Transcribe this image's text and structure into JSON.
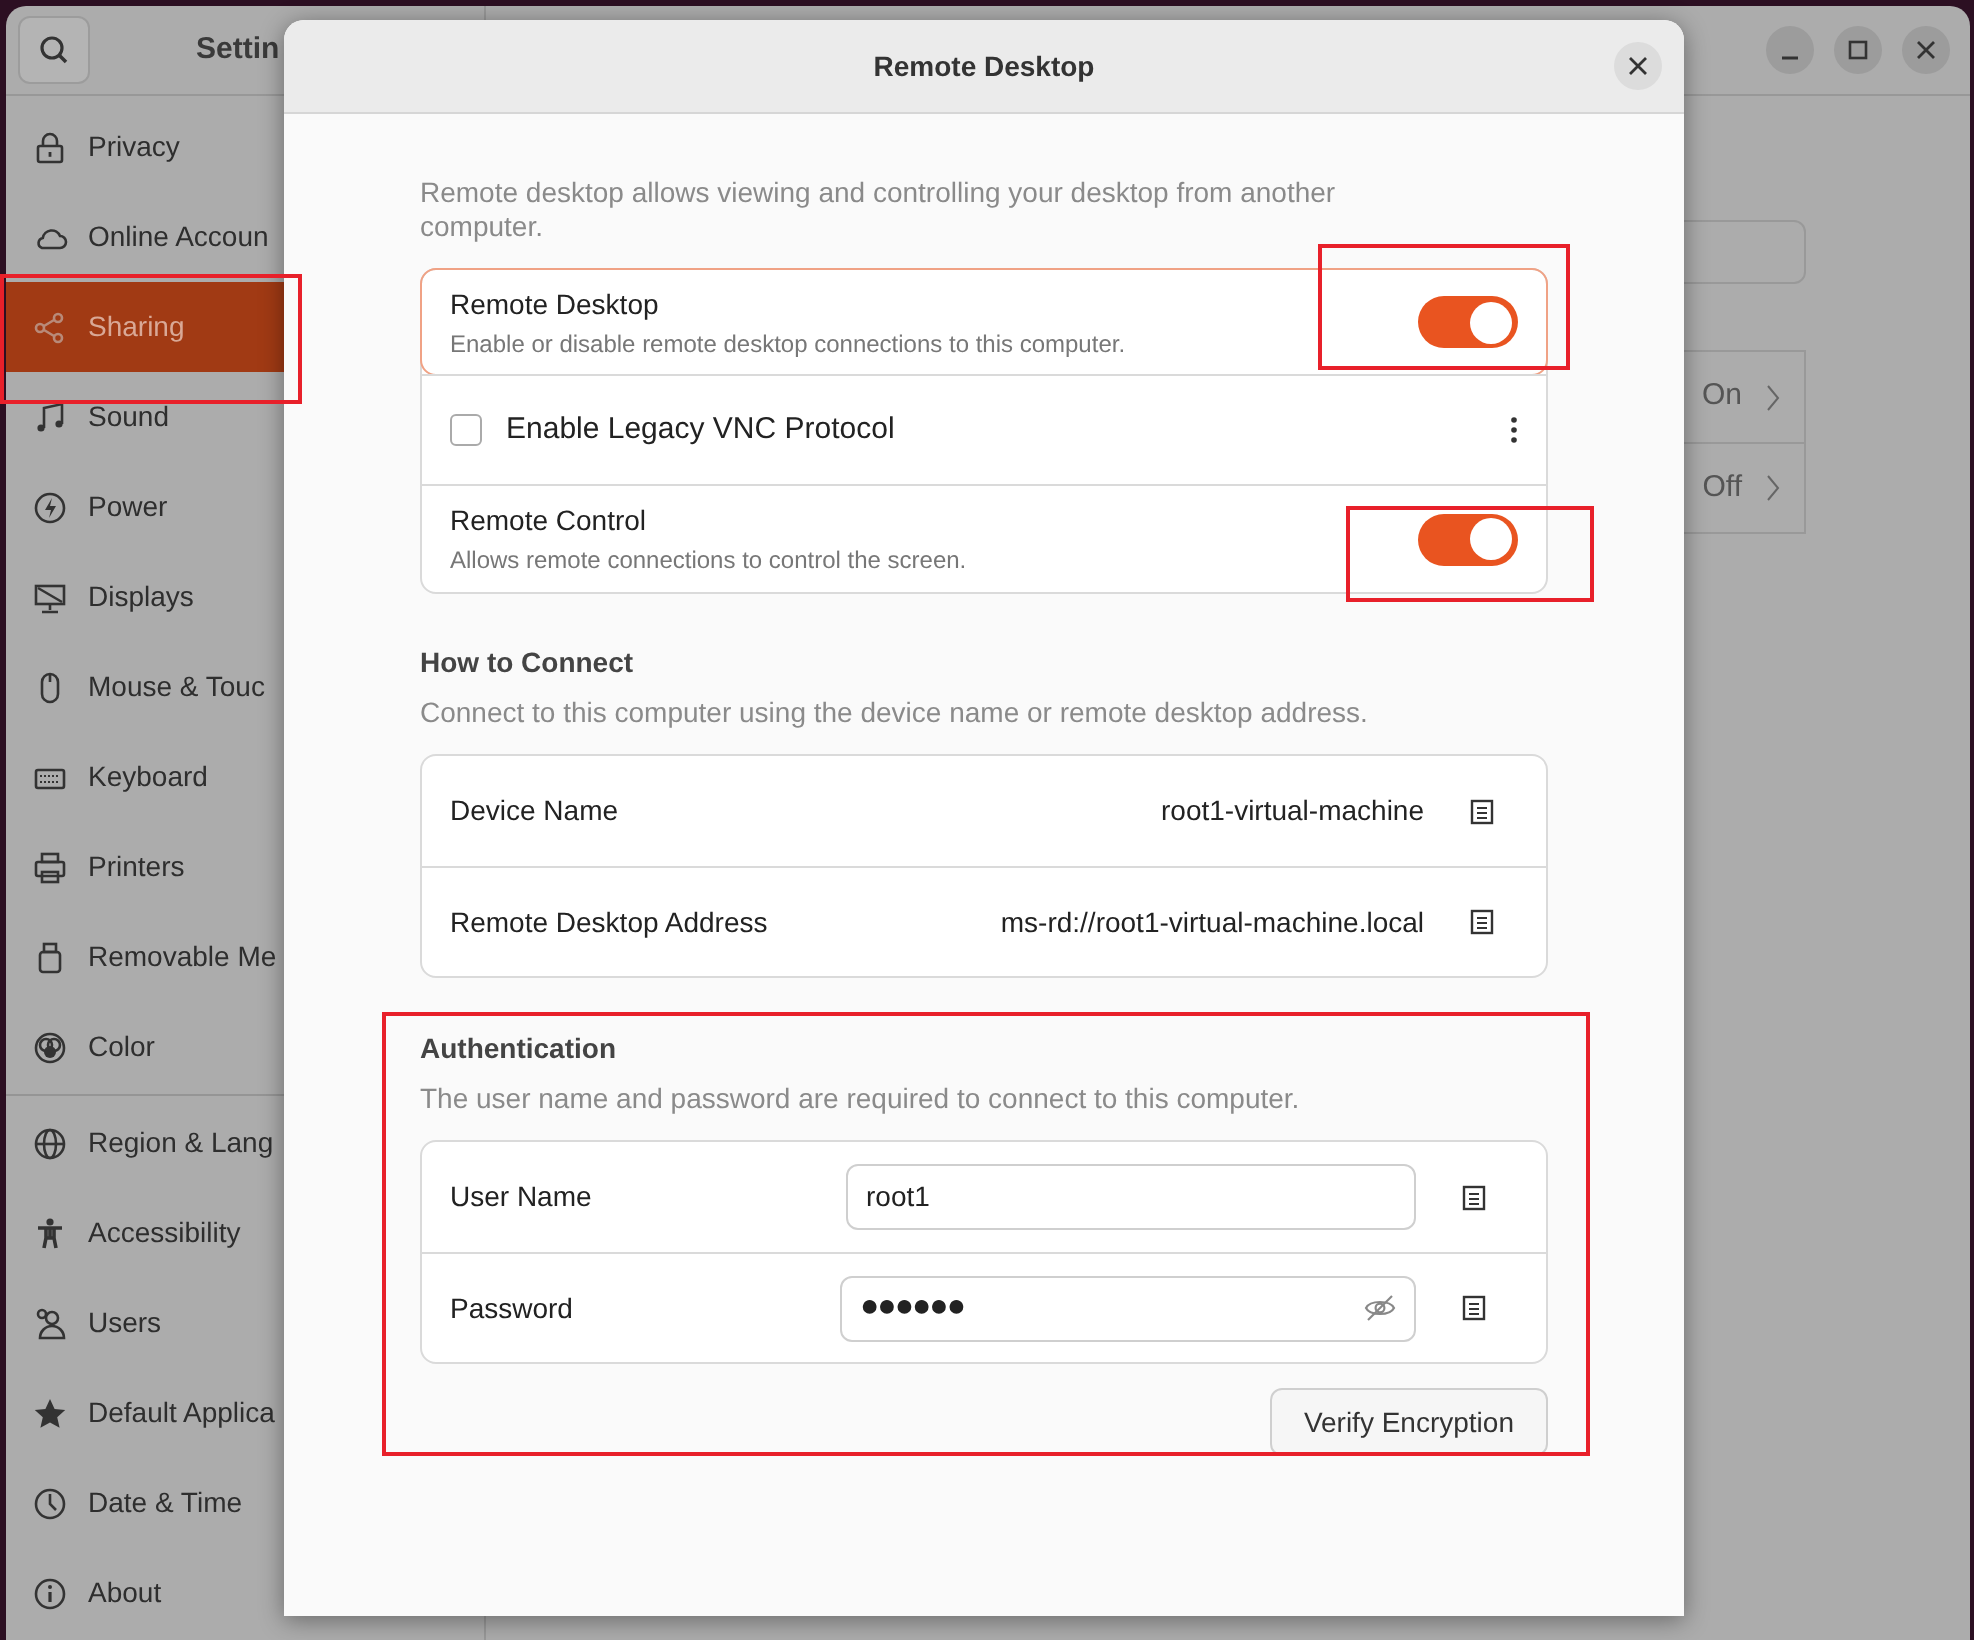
{
  "settings_window": {
    "title": "Settin",
    "sidebar": {
      "items": [
        {
          "label": "Privacy",
          "selected": false
        },
        {
          "label": "Online Accoun",
          "selected": false
        },
        {
          "label": "Sharing",
          "selected": true
        },
        {
          "label": "Sound",
          "selected": false
        },
        {
          "label": "Power",
          "selected": false
        },
        {
          "label": "Displays",
          "selected": false
        },
        {
          "label": "Mouse & Touc",
          "selected": false
        },
        {
          "label": "Keyboard",
          "selected": false
        },
        {
          "label": "Printers",
          "selected": false
        },
        {
          "label": "Removable Me",
          "selected": false
        },
        {
          "label": "Color",
          "selected": false
        },
        {
          "label": "Region & Lang",
          "selected": false
        },
        {
          "label": "Accessibility",
          "selected": false
        },
        {
          "label": "Users",
          "selected": false
        },
        {
          "label": "Default Applica",
          "selected": false
        },
        {
          "label": "Date & Time",
          "selected": false
        },
        {
          "label": "About",
          "selected": false
        }
      ]
    },
    "content_rows": [
      {
        "value": "On"
      },
      {
        "value": "Off"
      }
    ]
  },
  "dialog": {
    "title": "Remote Desktop",
    "description": "Remote desktop allows viewing and controlling your desktop from another computer.",
    "switch_rows": [
      {
        "kind": "switch",
        "title": "Remote Desktop",
        "subtitle": "Enable or disable remote desktop connections to this computer.",
        "on": true
      },
      {
        "kind": "checkbox",
        "title": "Enable Legacy VNC Protocol",
        "checked": false
      },
      {
        "kind": "switch",
        "title": "Remote Control",
        "subtitle": "Allows remote connections to control the screen.",
        "on": true
      }
    ],
    "how_to_connect": {
      "heading": "How to Connect",
      "subtitle": "Connect to this computer using the device name or remote desktop address.",
      "rows": [
        {
          "label": "Device Name",
          "value": "root1-virtual-machine"
        },
        {
          "label": "Remote Desktop Address",
          "value": "ms-rd://root1-virtual-machine.local"
        }
      ]
    },
    "authentication": {
      "heading": "Authentication",
      "subtitle": "The user name and password are required to connect to this computer.",
      "user_name_label": "User Name",
      "user_name": "root1",
      "password_label": "Password",
      "password": "●●●●●●",
      "button": "Verify Encryption"
    }
  }
}
